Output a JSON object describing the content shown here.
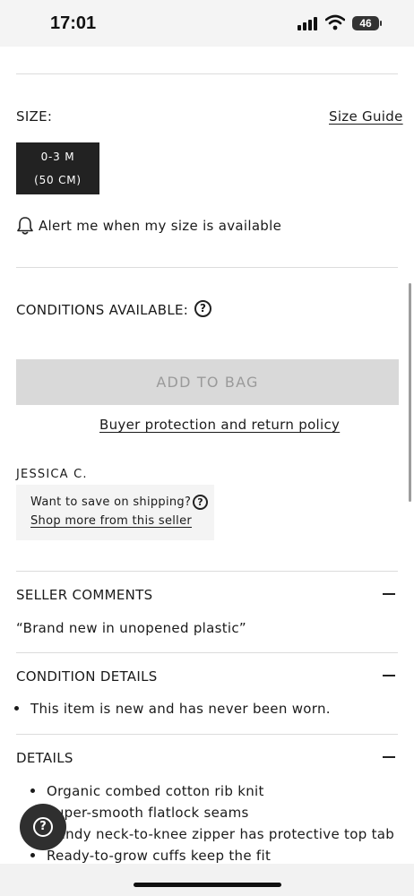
{
  "status_bar": {
    "time": "17:01",
    "battery": "46"
  },
  "size_section": {
    "label": "SIZE:",
    "size_guide_link": "Size Guide",
    "selected_size": {
      "line1": "0-3 M",
      "line2": "(50 CM)"
    },
    "alert_text": "Alert me when my size is available"
  },
  "conditions": {
    "label": "CONDITIONS AVAILABLE:"
  },
  "add_to_bag": {
    "label": "ADD TO BAG"
  },
  "buyer_protection_link": "Buyer protection and return policy",
  "seller": {
    "name": "JESSICA C.",
    "shipping_prompt": "Want to save on shipping?",
    "shop_more_link": "Shop more from this seller"
  },
  "seller_comments": {
    "title": "SELLER COMMENTS",
    "text": "“Brand new in unopened plastic”"
  },
  "condition_details": {
    "title": "CONDITION DETAILS",
    "items": [
      "This item is new and has never been worn."
    ]
  },
  "details": {
    "title": "DETAILS",
    "items": [
      "Organic combed cotton rib knit",
      "Super-smooth flatlock seams",
      "Handy neck-to-knee zipper has protective top tab",
      "Ready-to-grow cuffs keep the fit"
    ]
  },
  "icons": {
    "bell": "bell-icon",
    "help": "question-circle-icon",
    "collapse": "minus-icon",
    "help_fab": "help-chat-icon"
  },
  "colors": {
    "chip": "#222222",
    "button_disabled": "#d9d9d9",
    "button_text_disabled": "#9a9a9a"
  }
}
